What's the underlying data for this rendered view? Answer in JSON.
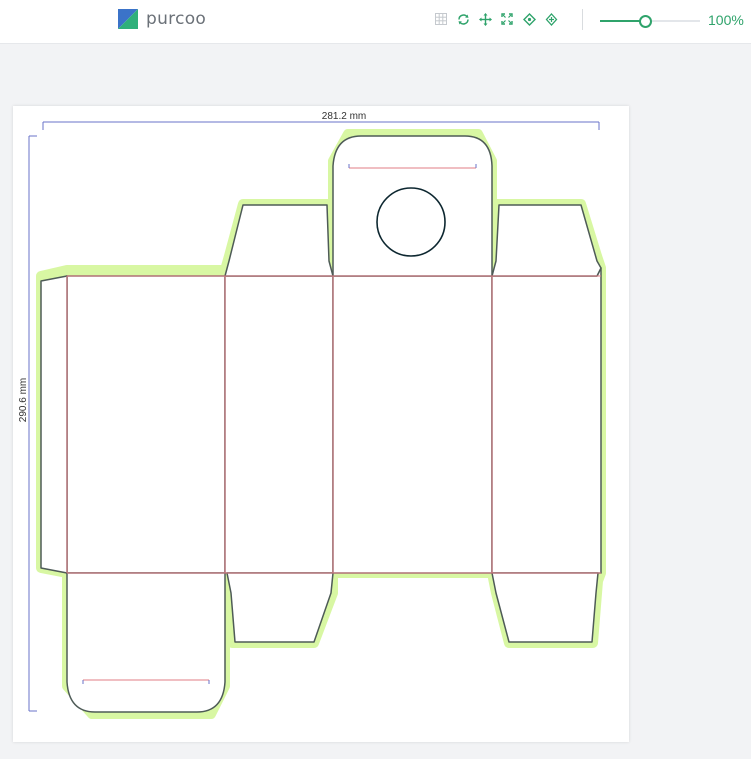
{
  "app": {
    "logo_text": "purcoo"
  },
  "toolbar": {
    "tools": [
      {
        "icon": "grid-icon"
      },
      {
        "icon": "rotate-icon"
      },
      {
        "icon": "move-icon"
      },
      {
        "icon": "fit-icon"
      },
      {
        "icon": "tag-icon"
      },
      {
        "icon": "crosshair-icon"
      }
    ],
    "zoom": {
      "value": 0.45,
      "label": "100%"
    }
  },
  "dieline": {
    "width_label": "281.2 mm",
    "height_label": "290.6 mm",
    "colors": {
      "cut": "#4e5b57",
      "fold": "#e27d86",
      "bleed": "#d8f7a3",
      "dimension": "#6873c8",
      "hole": "#0d2730",
      "accent": "#2fa36b"
    }
  }
}
